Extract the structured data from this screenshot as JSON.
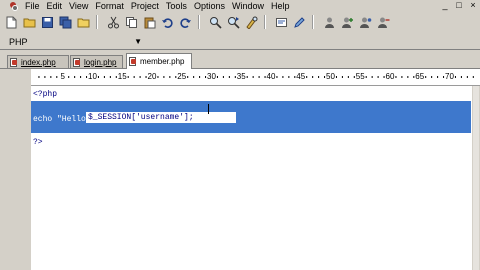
{
  "menu": {
    "items": [
      "File",
      "Edit",
      "View",
      "Format",
      "Project",
      "Tools",
      "Options",
      "Window",
      "Help"
    ]
  },
  "window_controls": {
    "minimize": "_",
    "restore": "□",
    "close": "×"
  },
  "toolbar": {
    "buttons": [
      "new-file-icon",
      "open-folder-icon",
      "save-icon",
      "save-all-icon",
      "folder-icon",
      "cut-icon",
      "copy-icon",
      "paste-icon",
      "undo-icon",
      "redo-icon",
      "find-icon",
      "find-next-icon",
      "replace-icon",
      "toggle-icon",
      "edit-icon",
      "user-icon",
      "user-add-icon",
      "user-edit-icon",
      "user-remove-icon"
    ]
  },
  "language": {
    "selected": "PHP"
  },
  "tabs": [
    {
      "label": "index.php",
      "active": false
    },
    {
      "label": "login.php",
      "active": false
    },
    {
      "label": "member.php",
      "active": true
    }
  ],
  "ruler": {
    "labels": [
      "5",
      "10",
      "15",
      "20",
      "25",
      "30",
      "35",
      "40",
      "45",
      "50",
      "55",
      "60",
      "65",
      "70",
      "75"
    ]
  },
  "code": {
    "line1": "<?php",
    "line2": "echo \"Hello, \".$_SESSION['username'];",
    "line2_selected": "echo \"Hello, \"",
    "line2_rest": "$_SESSION['username'];",
    "line3": "?>"
  },
  "colors": {
    "selection": "#3e78cc",
    "code_text": "#000080",
    "chrome": "#d4d0c8"
  }
}
